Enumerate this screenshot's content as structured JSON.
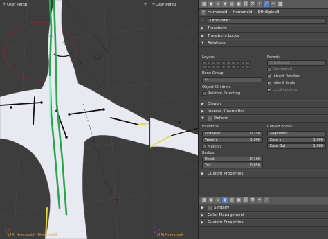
{
  "viewport_left": {
    "label": "User Persp",
    "footer": "(18) Humanoid : DthrSpine3"
  },
  "viewport_right": {
    "label": "User Persp",
    "footer": "(18) Humanoid"
  },
  "properties": {
    "breadcrumbs": [
      "Humanoid",
      "Humanoid",
      "DthrSpine3"
    ],
    "bone_name": "DthrSpine3",
    "panels": {
      "transform": "Transform",
      "transform_locks": "Transform Locks",
      "relations": "Relations",
      "display": "Display",
      "inverse_kinematics": "Inverse Kinematics",
      "deform": "Deform",
      "custom_properties": "Custom Properties"
    },
    "relations": {
      "layers_label": "Layers:",
      "parent_label": "Parent:",
      "parent_value": "DthrSpine2",
      "connected": "Connected",
      "inherit_rotation": "Inherit Rotation",
      "inherit_scale": "Inherit Scale",
      "local_location": "Local Location",
      "bone_group_label": "Bone Group:",
      "object_children_label": "Object Children:",
      "relative_parenting": "Relative Parenting"
    },
    "deform": {
      "envelope_label": "Envelope:",
      "distance_label": "Distance:",
      "distance_value": "0.250",
      "weight_label": "Weight:",
      "weight_value": "1.000",
      "multiply": "Multiply",
      "radius_label": "Radius:",
      "head_label": "Head:",
      "head_value": "0.100",
      "tail_label": "Tail:",
      "tail_value": "0.050",
      "curved_bones_label": "Curved Bones:",
      "segments_label": "Segments:",
      "segments_value": "1",
      "ease_in_label": "Ease In:",
      "ease_in_value": "1.000",
      "ease_out_label": "Ease Out:",
      "ease_out_value": "1.000"
    },
    "lower_panels": {
      "simplify": "Simplify",
      "color_management": "Color Management",
      "custom_properties": "Custom Properties"
    }
  }
}
